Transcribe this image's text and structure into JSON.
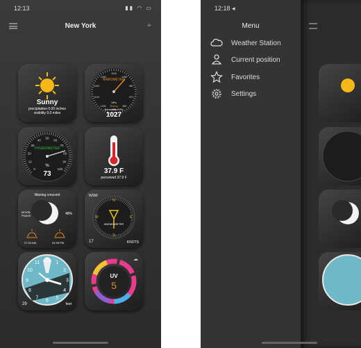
{
  "left_phone": {
    "status": {
      "time": "12:13",
      "icons": "▮▮ ◠ ▭"
    },
    "nav": {
      "title": "New York"
    },
    "tiles": {
      "sunny": {
        "title": "Sunny",
        "line1": "precipitation 0.00 inches",
        "line2": "visibility 9.0 miles"
      },
      "barometer": {
        "label": "BAROMETER",
        "sub1": "hPa",
        "sub2": "Rising",
        "sub3": "Barometer/hPa",
        "value": "1027",
        "ticks": [
          "1040",
          "1050",
          "960",
          "970",
          "980",
          "990",
          "1000",
          "1010",
          "1020",
          "1030"
        ]
      },
      "hygrometer": {
        "label": "HYGROMETER",
        "unit": "%",
        "value": "73",
        "ticks": [
          "0",
          "10",
          "20",
          "30",
          "40",
          "50",
          "60",
          "70",
          "80",
          "90",
          "100"
        ]
      },
      "thermometer": {
        "value": "37.9 F",
        "sub": "perceived 37.9 F"
      },
      "moon": {
        "title": "Waning crescent",
        "phase_label1": "MOON",
        "phase_label2": "PHASE",
        "percent": "48%",
        "sunrise": "07:20 AM",
        "sunset": "04:39 PM"
      },
      "wind": {
        "dir": "WSW",
        "label": "ANEMOMETER",
        "speed": "17",
        "unit": "KNOTS",
        "n": "N",
        "e": "E",
        "s": "S",
        "w": "W"
      },
      "clock": {
        "numbers": [
          "12",
          "1",
          "2",
          "3",
          "4",
          "5",
          "6",
          "7",
          "8",
          "9",
          "10",
          "11"
        ],
        "left": "29",
        "right": "feet"
      },
      "uv": {
        "label": "UV",
        "value": "5"
      }
    }
  },
  "right_phone": {
    "status": {
      "time": "12:18 ◂",
      "icons": "▮▮ ◠ ▭"
    },
    "menu": {
      "title": "Menu",
      "items": [
        {
          "label": "Weather Station",
          "icon": "cloud-icon"
        },
        {
          "label": "Current position",
          "icon": "person-pin-icon"
        },
        {
          "label": "Favorites",
          "icon": "star-icon"
        },
        {
          "label": "Settings",
          "icon": "gear-icon"
        }
      ]
    }
  },
  "colors": {
    "accent_orange": "#e58a1e",
    "green": "#2fbf3a",
    "background": "#2f2f2f"
  }
}
